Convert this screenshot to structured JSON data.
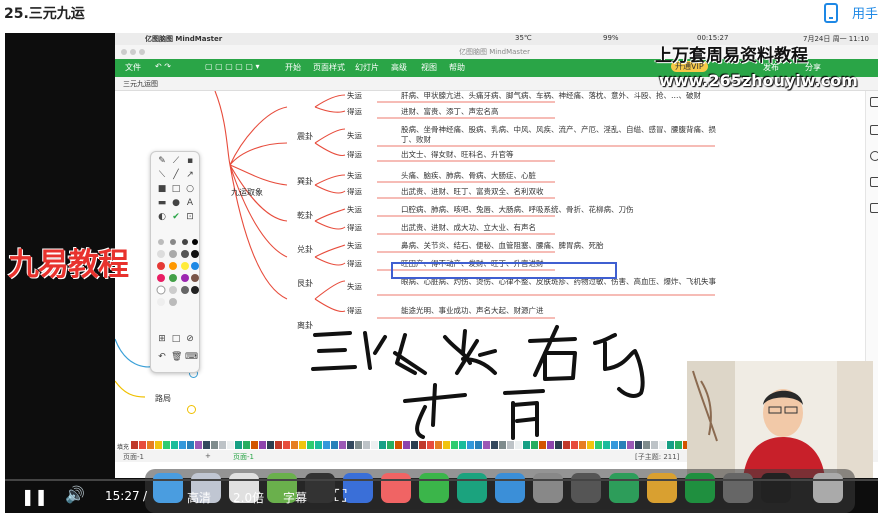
{
  "page": {
    "title": "25.三元九运",
    "use_phone": "用手"
  },
  "mac": {
    "menubar_temp": "35℃",
    "menubar_pct": "99%",
    "menubar_time": "00:15:27",
    "date": "7月24日 周一 11:10",
    "window_title": "亿图脑图 MindMaster",
    "app_title": "亿图脑图 MindMaster"
  },
  "ribbon": {
    "items": [
      "文件",
      "开始",
      "页面样式",
      "幻灯片",
      "高级",
      "视图",
      "帮助"
    ],
    "share": "开通VIP",
    "right": [
      "发布",
      "分享"
    ]
  },
  "doc_tab": "三元九运图",
  "watermark": {
    "line1": "上万套周易资料教程",
    "line2": "www.265zhouyiw.com"
  },
  "brand": "九易教程",
  "mindmap": {
    "root": "九运取象",
    "route": "路局",
    "branches": [
      {
        "topic": "震卦",
        "rows": [
          {
            "label": "失运",
            "text": "肝病、甲状腺亢进、头痛牙病、脚气病、车祸、神经痛、落枕、意外、斗殴、抢、…、破财"
          },
          {
            "label": "得运",
            "text": "进财、富贵、添丁、声宏名高"
          }
        ]
      },
      {
        "topic": "巽卦",
        "rows": [
          {
            "label": "失运",
            "text": "股病、坐骨神经痛、股病、乳病、中风、风疾、流产、产厄、淫乱、自缢、感冒、腰腹背痛、损丁、败财"
          },
          {
            "label": "得运",
            "text": "出文士、得女财、旺科名、升官等"
          }
        ]
      },
      {
        "topic": "乾卦",
        "rows": [
          {
            "label": "失运",
            "text": "头痛、脑疾、肺病、骨病、大肠症、心脏"
          },
          {
            "label": "得运",
            "text": "出武贵、进财、旺丁、富贵双全、名利双收"
          }
        ]
      },
      {
        "topic": "兑卦",
        "rows": [
          {
            "label": "失运",
            "text": "口腔病、肺病、咳吧、兔唇、大肠病、呼吸系统、骨折、花柳病、刀伤"
          },
          {
            "label": "得运",
            "text": "出武贵、进财、成大功、立大业、有声名"
          }
        ]
      },
      {
        "topic": "艮卦",
        "rows": [
          {
            "label": "失运",
            "text": "鼻病、关节炎、结石、便秘、血管阻塞、腰痛、脾胃病、死胎"
          },
          {
            "label": "得运",
            "text": "旺田产、得不动产、发财、旺丁、升官进财"
          }
        ]
      },
      {
        "topic": "离卦",
        "rows": [
          {
            "label": "失运",
            "text": "眼病、心脏病、灼伤、烫伤、心律不整、皮肤斑疹、药物过敏、伤害、高血压、爆炸、飞机失事"
          },
          {
            "label": "得运",
            "text": "能途光明、事业成功、声名大起、财源广进"
          }
        ]
      }
    ]
  },
  "status": {
    "page": "页面-1",
    "add": "+",
    "tab": "页面-1",
    "topic_count": "[子主题: 211]",
    "fill_label": "填充"
  },
  "player": {
    "time": "15:27",
    "sep": "/",
    "quality": "高清",
    "speed": "2.0倍",
    "subtitle": "字幕"
  },
  "colors": {
    "accent": "#2aa547",
    "highlight": "#3f5fd1",
    "brand": "#e8322d"
  }
}
